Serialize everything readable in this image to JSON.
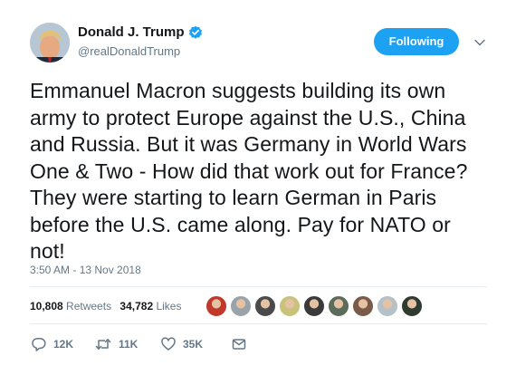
{
  "tweet": {
    "display_name": "Donald J. Trump",
    "handle": "@realDonaldTrump",
    "follow_button": "Following",
    "text": "Emmanuel Macron suggests building its own army to protect Europe against the U.S., China and Russia. But it was Germany in World Wars One & Two - How did that work out for France? They were starting to learn German in Paris before the U.S. came along. Pay for NATO or not!",
    "timestamp": "3:50 AM - 13 Nov 2018"
  },
  "stats": {
    "retweets_count": "10,808",
    "retweets_label": "Retweets",
    "likes_count": "34,782",
    "likes_label": "Likes"
  },
  "actions": {
    "reply_count": "12K",
    "retweet_count": "11K",
    "like_count": "35K"
  },
  "icons": {
    "verified": "verified-badge-icon",
    "caret": "chevron-down-icon",
    "reply": "reply-icon",
    "retweet": "retweet-icon",
    "like": "heart-icon",
    "dm": "envelope-icon"
  },
  "colors": {
    "accent": "#1da1f2",
    "text": "#14171a",
    "muted": "#657786",
    "divider": "#e6ecf0"
  },
  "likers": [
    {
      "color": "#c0392b"
    },
    {
      "color": "#9aa3a8"
    },
    {
      "color": "#4a4a4a"
    },
    {
      "color": "#c9c27a"
    },
    {
      "color": "#3a3a3a"
    },
    {
      "color": "#5c6b5a"
    },
    {
      "color": "#7a5a48"
    },
    {
      "color": "#b5c0c8"
    },
    {
      "color": "#2f3b2e"
    }
  ]
}
